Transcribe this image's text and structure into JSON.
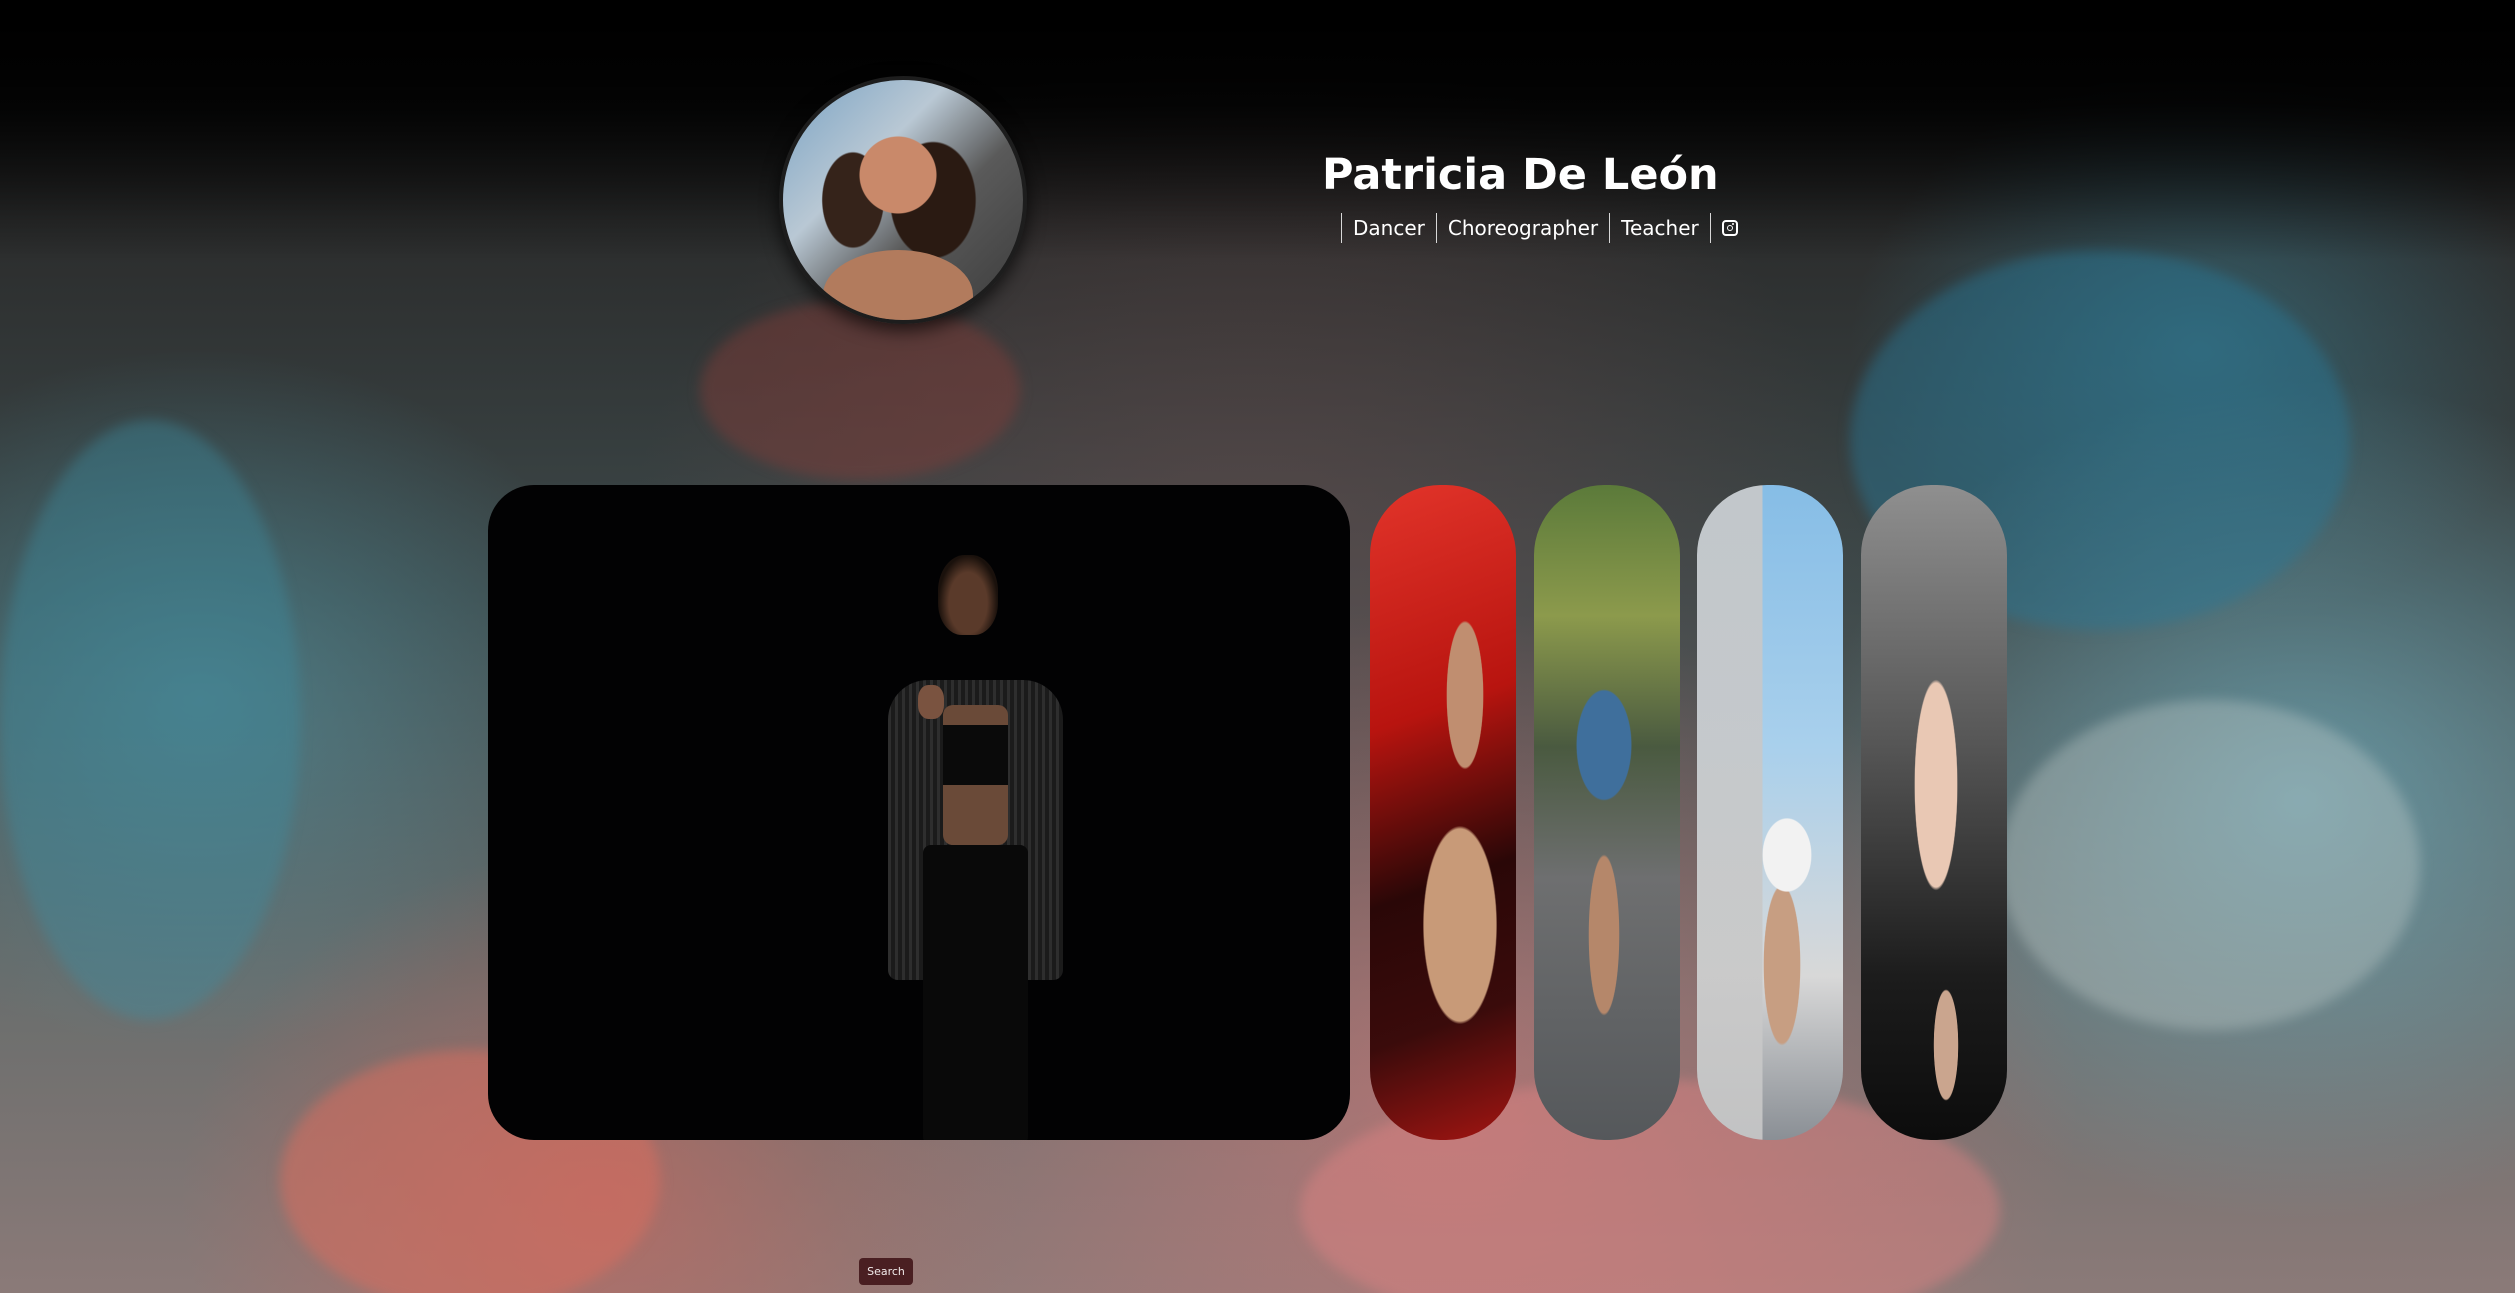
{
  "profile": {
    "name": "Patricia De León",
    "roles": [
      "Dancer",
      "Choreographer",
      "Teacher"
    ],
    "social_icon": "instagram-icon"
  },
  "gallery": {
    "images": [
      {
        "description_icon": "dancer-portrait-dark-stage"
      },
      {
        "description_icon": "dancer-red-fabric"
      },
      {
        "description_icon": "dancer-street-leap"
      },
      {
        "description_icon": "dancer-building-balance"
      },
      {
        "description_icon": "dancer-pink-dress"
      }
    ]
  },
  "search": {
    "label": "Search"
  },
  "colors": {
    "background_top": "#050505",
    "text": "#ffffff",
    "search_button": "#4a1f22"
  }
}
